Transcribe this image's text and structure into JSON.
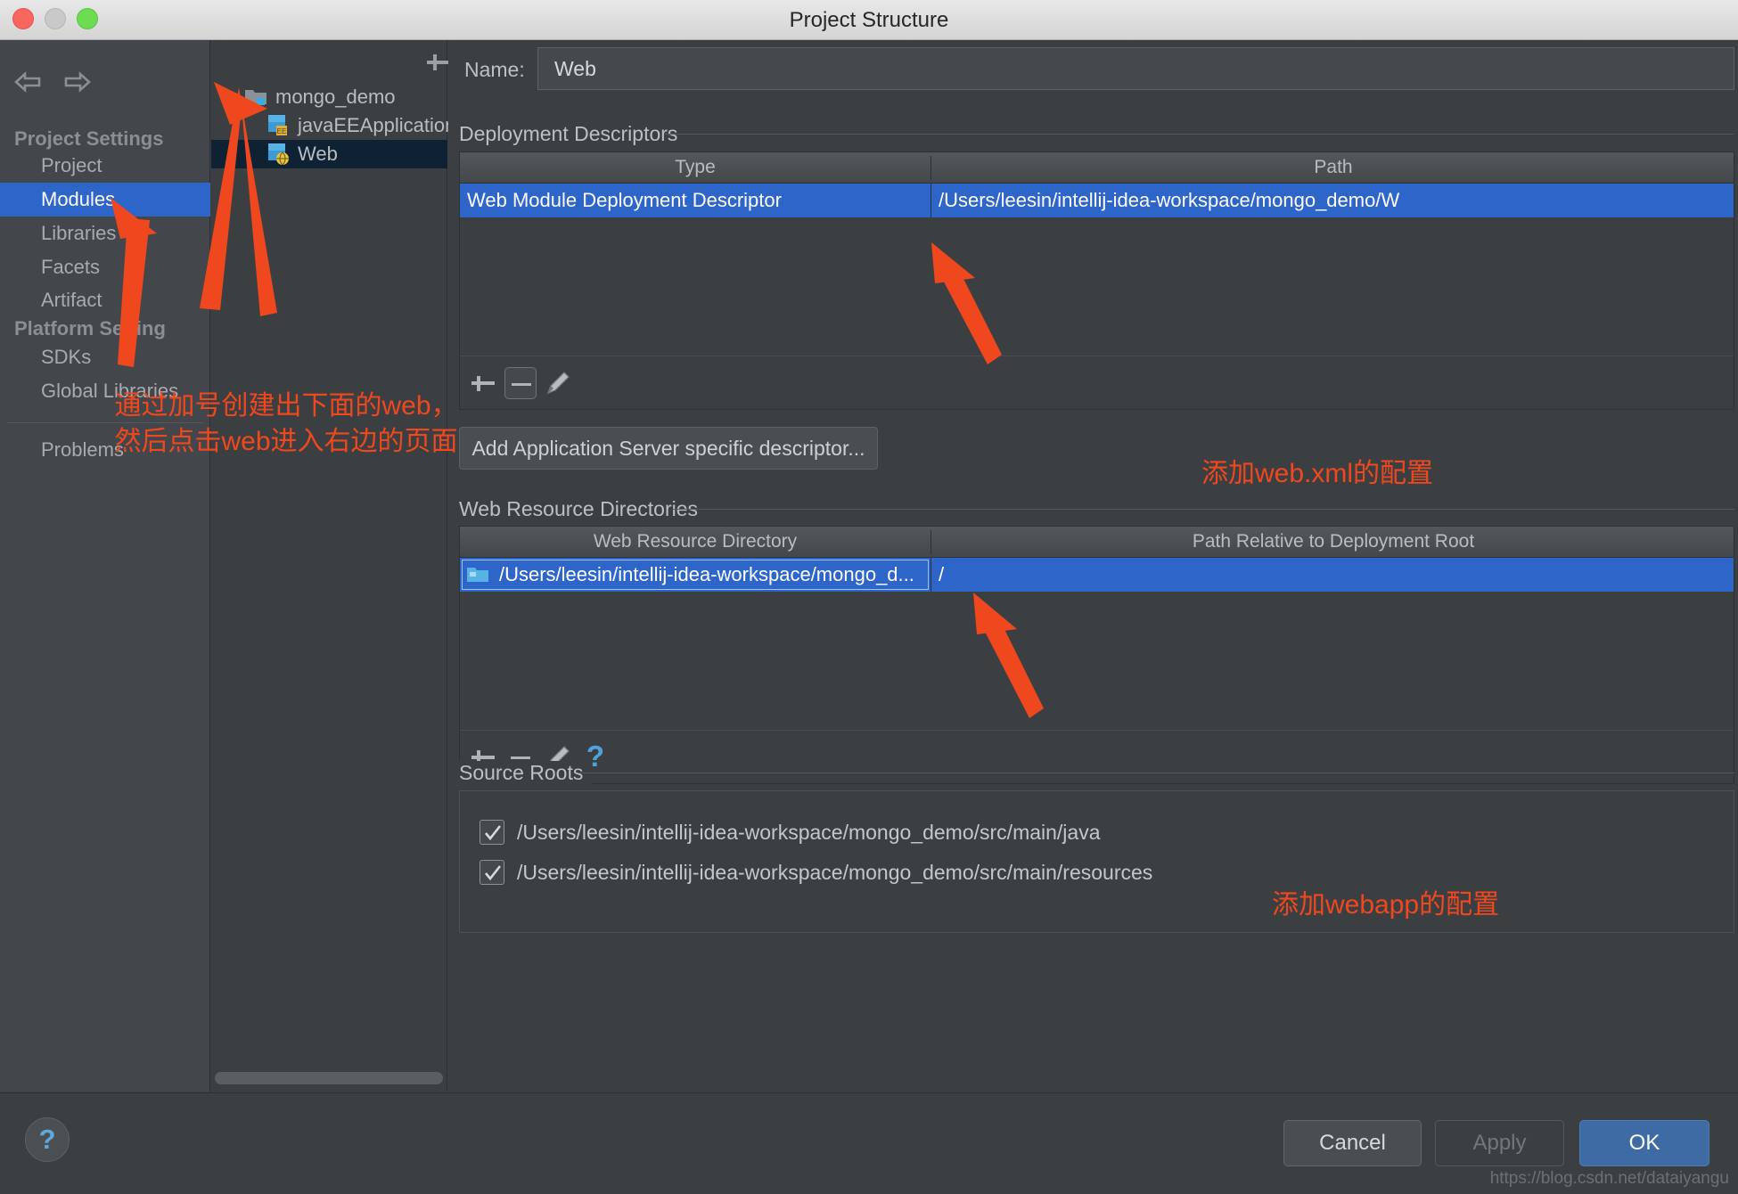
{
  "window": {
    "title": "Project Structure",
    "traffic_lights": [
      "close-red",
      "minimize-yellow",
      "zoom-green"
    ]
  },
  "sidebar": {
    "nav_back_icon": "arrow-left-icon",
    "nav_forward_icon": "arrow-right-icon",
    "groups": [
      {
        "header": "Project Settings",
        "items": [
          "Project",
          "Modules",
          "Libraries",
          "Facets",
          "Artifact"
        ]
      },
      {
        "header": "Platform Setting",
        "items": [
          "SDKs",
          "Global Libraries"
        ]
      }
    ],
    "selected_item": "Modules",
    "footer_item": "Problems"
  },
  "tree": {
    "toolbar": [
      {
        "name": "add-module-button",
        "icon": "plus-icon"
      },
      {
        "name": "remove-module-button",
        "icon": "minus-icon"
      },
      {
        "name": "copy-module-button",
        "icon": "copy-icon"
      }
    ],
    "nodes": [
      {
        "label": "mongo_demo",
        "icon": "folder-module-icon",
        "depth": 0,
        "expanded": true,
        "selected": false
      },
      {
        "label": "javaEEApplication",
        "icon": "javaee-module-icon",
        "depth": 1,
        "expanded": false,
        "selected": false
      },
      {
        "label": "Web",
        "icon": "web-module-icon",
        "depth": 1,
        "expanded": false,
        "selected": true
      }
    ]
  },
  "main": {
    "name_label": "Name:",
    "name_value": "Web",
    "deployment": {
      "title": "Deployment Descriptors",
      "columns": [
        "Type",
        "Path"
      ],
      "rows": [
        {
          "type": "Web Module Deployment Descriptor",
          "path": "/Users/leesin/intellij-idea-workspace/mongo_demo/W"
        }
      ],
      "toolbar": [
        {
          "name": "add-descriptor-button",
          "icon": "plus-icon"
        },
        {
          "name": "remove-descriptor-button",
          "icon": "minus-icon"
        },
        {
          "name": "edit-descriptor-button",
          "icon": "pencil-icon"
        }
      ],
      "add_server_descriptor_button": "Add Application Server specific descriptor..."
    },
    "web_resources": {
      "title": "Web Resource Directories",
      "columns": [
        "Web Resource Directory",
        "Path Relative to Deployment Root"
      ],
      "rows": [
        {
          "directory": "/Users/leesin/intellij-idea-workspace/mongo_d...",
          "relative_path": "/"
        }
      ],
      "toolbar": [
        {
          "name": "add-web-resource-button",
          "icon": "plus-icon"
        },
        {
          "name": "remove-web-resource-button",
          "icon": "minus-icon"
        },
        {
          "name": "edit-web-resource-button",
          "icon": "pencil-icon"
        },
        {
          "name": "web-resource-help-button",
          "icon": "question-icon"
        }
      ]
    },
    "source_roots": {
      "title": "Source Roots",
      "items": [
        {
          "checked": true,
          "path": "/Users/leesin/intellij-idea-workspace/mongo_demo/src/main/java"
        },
        {
          "checked": true,
          "path": "/Users/leesin/intellij-idea-workspace/mongo_demo/src/main/resources"
        }
      ]
    }
  },
  "footer": {
    "help_icon": "question-icon",
    "cancel": "Cancel",
    "apply": "Apply",
    "ok": "OK",
    "watermark": "https://blog.csdn.net/dataiyangu"
  },
  "annotations": {
    "left_line1": "通过加号创建出下面的web，",
    "left_line2": "然后点击web进入右边的页面",
    "webxml": "添加web.xml的配置",
    "webapp": "添加webapp的配置",
    "color": "#f0481e"
  }
}
